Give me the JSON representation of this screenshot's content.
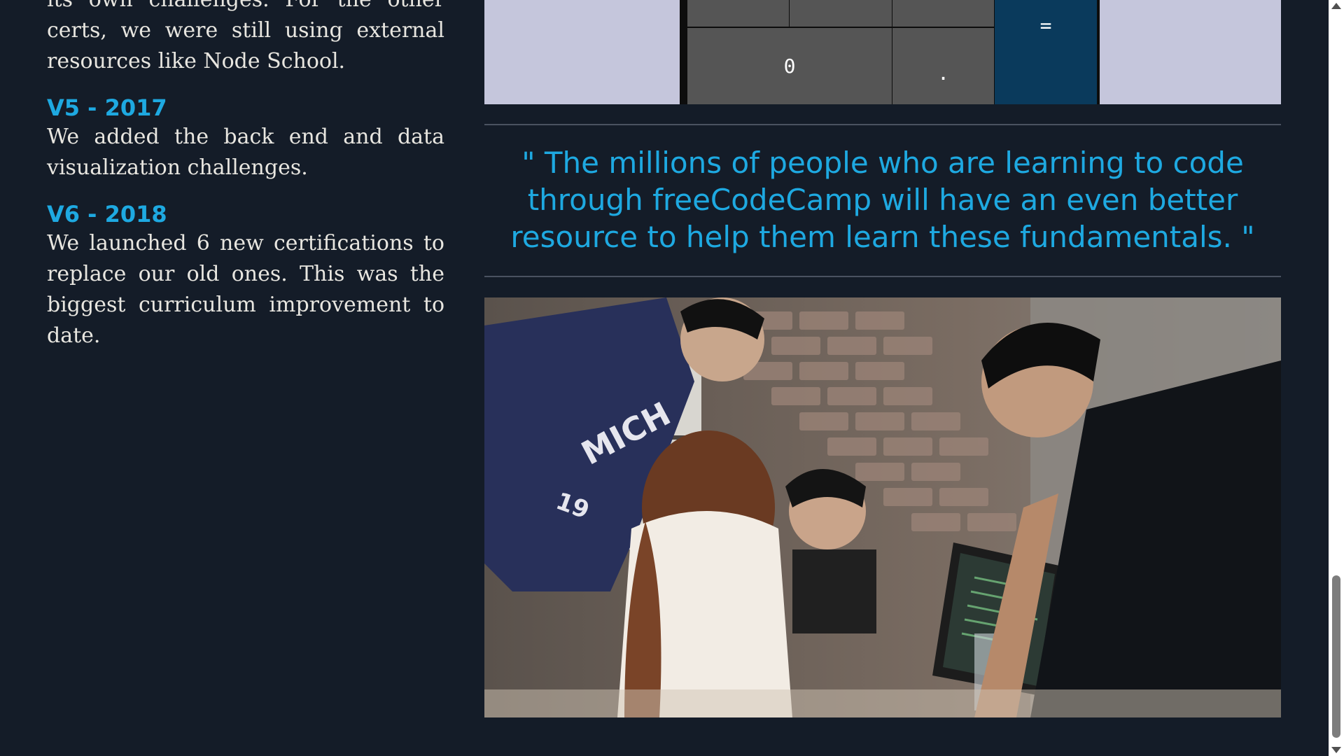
{
  "left": {
    "intro_text": "its own challenges. For the other certs, we were still using external resources like Node School.",
    "versions": [
      {
        "heading": "V5 - 2017",
        "text": "We added the back end and data visualization challenges."
      },
      {
        "heading": "V6 - 2018",
        "text": "We launched 6 new certifications to replace our old ones. This was the biggest curriculum improvement to date."
      }
    ]
  },
  "calculator": {
    "zero_key": "0",
    "decimal_key": ".",
    "equals_key": "="
  },
  "quote": {
    "text": "\" The millions of people who are learning to code through freeCodeCamp will have an even better resource to help them learn these fundamentals. \""
  },
  "photo": {
    "shirt_text": "MICH",
    "shirt_number": "19"
  },
  "colors": {
    "background": "#141c28",
    "accent": "#1ea9e1",
    "text": "#e8e6e0",
    "calc_panel": "#c5c6dc",
    "calc_key": "#555555",
    "calc_equals": "#0a3a5c"
  },
  "icons": {
    "scroll_up": "triangle-up-icon",
    "scroll_down": "triangle-down-icon"
  }
}
